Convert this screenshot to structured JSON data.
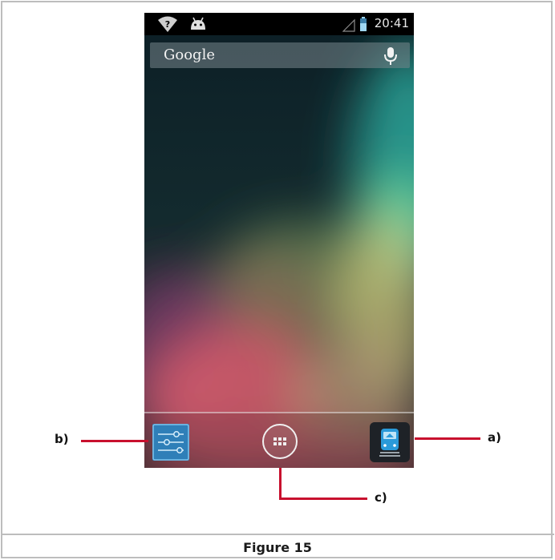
{
  "statusbar": {
    "time": "20:41",
    "icons": [
      "wifi-question-icon",
      "android-icon",
      "signal-icon",
      "battery-icon"
    ]
  },
  "search": {
    "label": "Google",
    "mic_icon": "microphone-icon"
  },
  "dock": {
    "left_app_icon": "settings-sliders-icon",
    "center_app_icon": "app-drawer-icon",
    "right_app_icon": "train-app-icon"
  },
  "callouts": {
    "a": "a)",
    "b": "b)",
    "c": "c)"
  },
  "caption": "Figure 15",
  "colors": {
    "callout_red": "#c8102e",
    "settings_blue": "#2f7fb8",
    "train_bg": "#1e2227",
    "train_blue": "#2a9ad9"
  }
}
